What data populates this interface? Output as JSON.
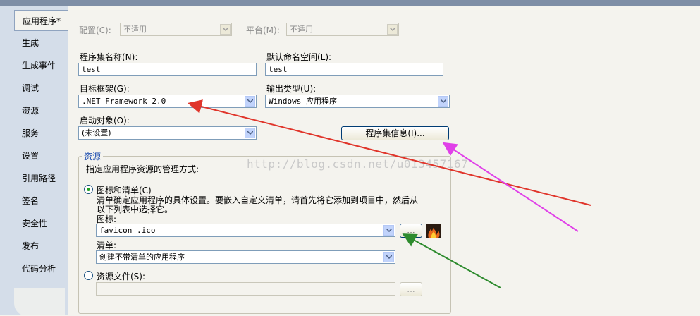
{
  "sidebar": {
    "tabs": [
      "应用程序*",
      "生成",
      "生成事件",
      "调试",
      "资源",
      "服务",
      "设置",
      "引用路径",
      "签名",
      "安全性",
      "发布",
      "代码分析"
    ]
  },
  "config": {
    "config_label": "配置(C):",
    "config_value": "不适用",
    "platform_label": "平台(M):",
    "platform_value": "不适用"
  },
  "assembly": {
    "name_label": "程序集名称(N):",
    "name_value": "test",
    "namespace_label": "默认命名空间(L):",
    "namespace_value": "test",
    "framework_label": "目标框架(G):",
    "framework_value": ".NET Framework 2.0",
    "output_label": "输出类型(U):",
    "output_value": "Windows 应用程序",
    "startup_label": "启动对象(O):",
    "startup_value": "(未设置)",
    "info_button": "程序集信息(I)..."
  },
  "resources": {
    "group_title": "资源",
    "desc": "指定应用程序资源的管理方式:",
    "icon_manifest_label": "图标和清单(C)",
    "icon_manifest_desc_1": "清单确定应用程序的具体设置。要嵌入自定义清单，请首先将它添加到项目中，然后从",
    "icon_manifest_desc_2": "以下列表中选择它。",
    "icon_label": "图标:",
    "icon_value": "favicon .ico",
    "browse_button": "...",
    "manifest_label": "清单:",
    "manifest_value": "创建不带清单的应用程序",
    "resource_file_label": "资源文件(S):",
    "resource_file_value": "",
    "resource_browse_button": "..."
  },
  "watermark": "http://blog.csdn.net/u013457167",
  "colors": {
    "red_arrow": "#e0352b",
    "magenta_arrow": "#e040e8",
    "green_arrow": "#2e8b2e"
  }
}
